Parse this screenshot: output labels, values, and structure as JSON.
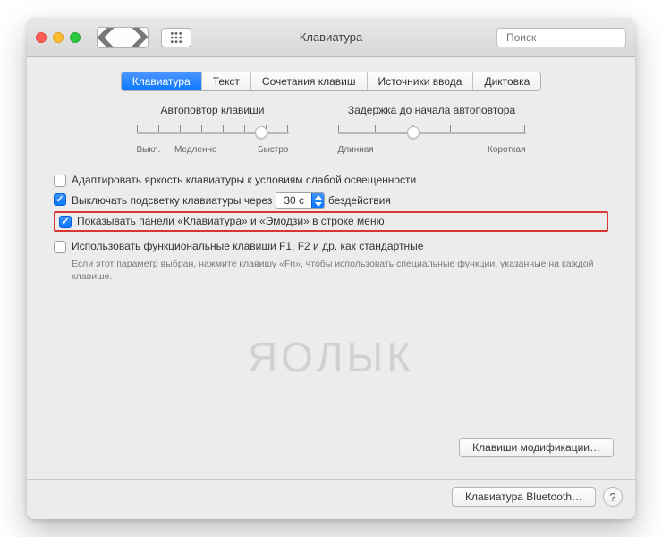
{
  "window": {
    "title": "Клавиатура"
  },
  "search": {
    "placeholder": "Поиск"
  },
  "tabs": [
    {
      "label": "Клавиатура",
      "active": true
    },
    {
      "label": "Текст",
      "active": false
    },
    {
      "label": "Сочетания клавиш",
      "active": false
    },
    {
      "label": "Источники ввода",
      "active": false
    },
    {
      "label": "Диктовка",
      "active": false
    }
  ],
  "sliders": {
    "repeat": {
      "title": "Автоповтор клавиши",
      "left": "Выкл.",
      "mid": "Медленно",
      "right": "Быстро",
      "knob_pct": 82
    },
    "delay": {
      "title": "Задержка до начала автоповтора",
      "left": "Длинная",
      "right": "Короткая",
      "knob_pct": 40
    }
  },
  "options": {
    "adapt": {
      "checked": false,
      "label": "Адаптировать яркость клавиатуры к условиям слабой освещенности"
    },
    "backlight": {
      "checked": true,
      "pre": "Выключать подсветку клавиатуры через",
      "value": "30 с",
      "post": "бездействия"
    },
    "showpanel": {
      "checked": true,
      "label": "Показывать панели «Клавиатура» и «Эмодзи» в строке меню"
    },
    "fnkeys": {
      "checked": false,
      "label": "Использовать функциональные клавиши F1, F2 и др. как стандартные",
      "help": "Если этот параметр выбран, нажмите клавишу «Fn», чтобы использовать специальные функции, указанные на каждой клавише."
    }
  },
  "buttons": {
    "modifier": "Клавиши модификации…",
    "bluetooth": "Клавиатура Bluetooth…"
  },
  "watermark": "ЯОЛЫК"
}
